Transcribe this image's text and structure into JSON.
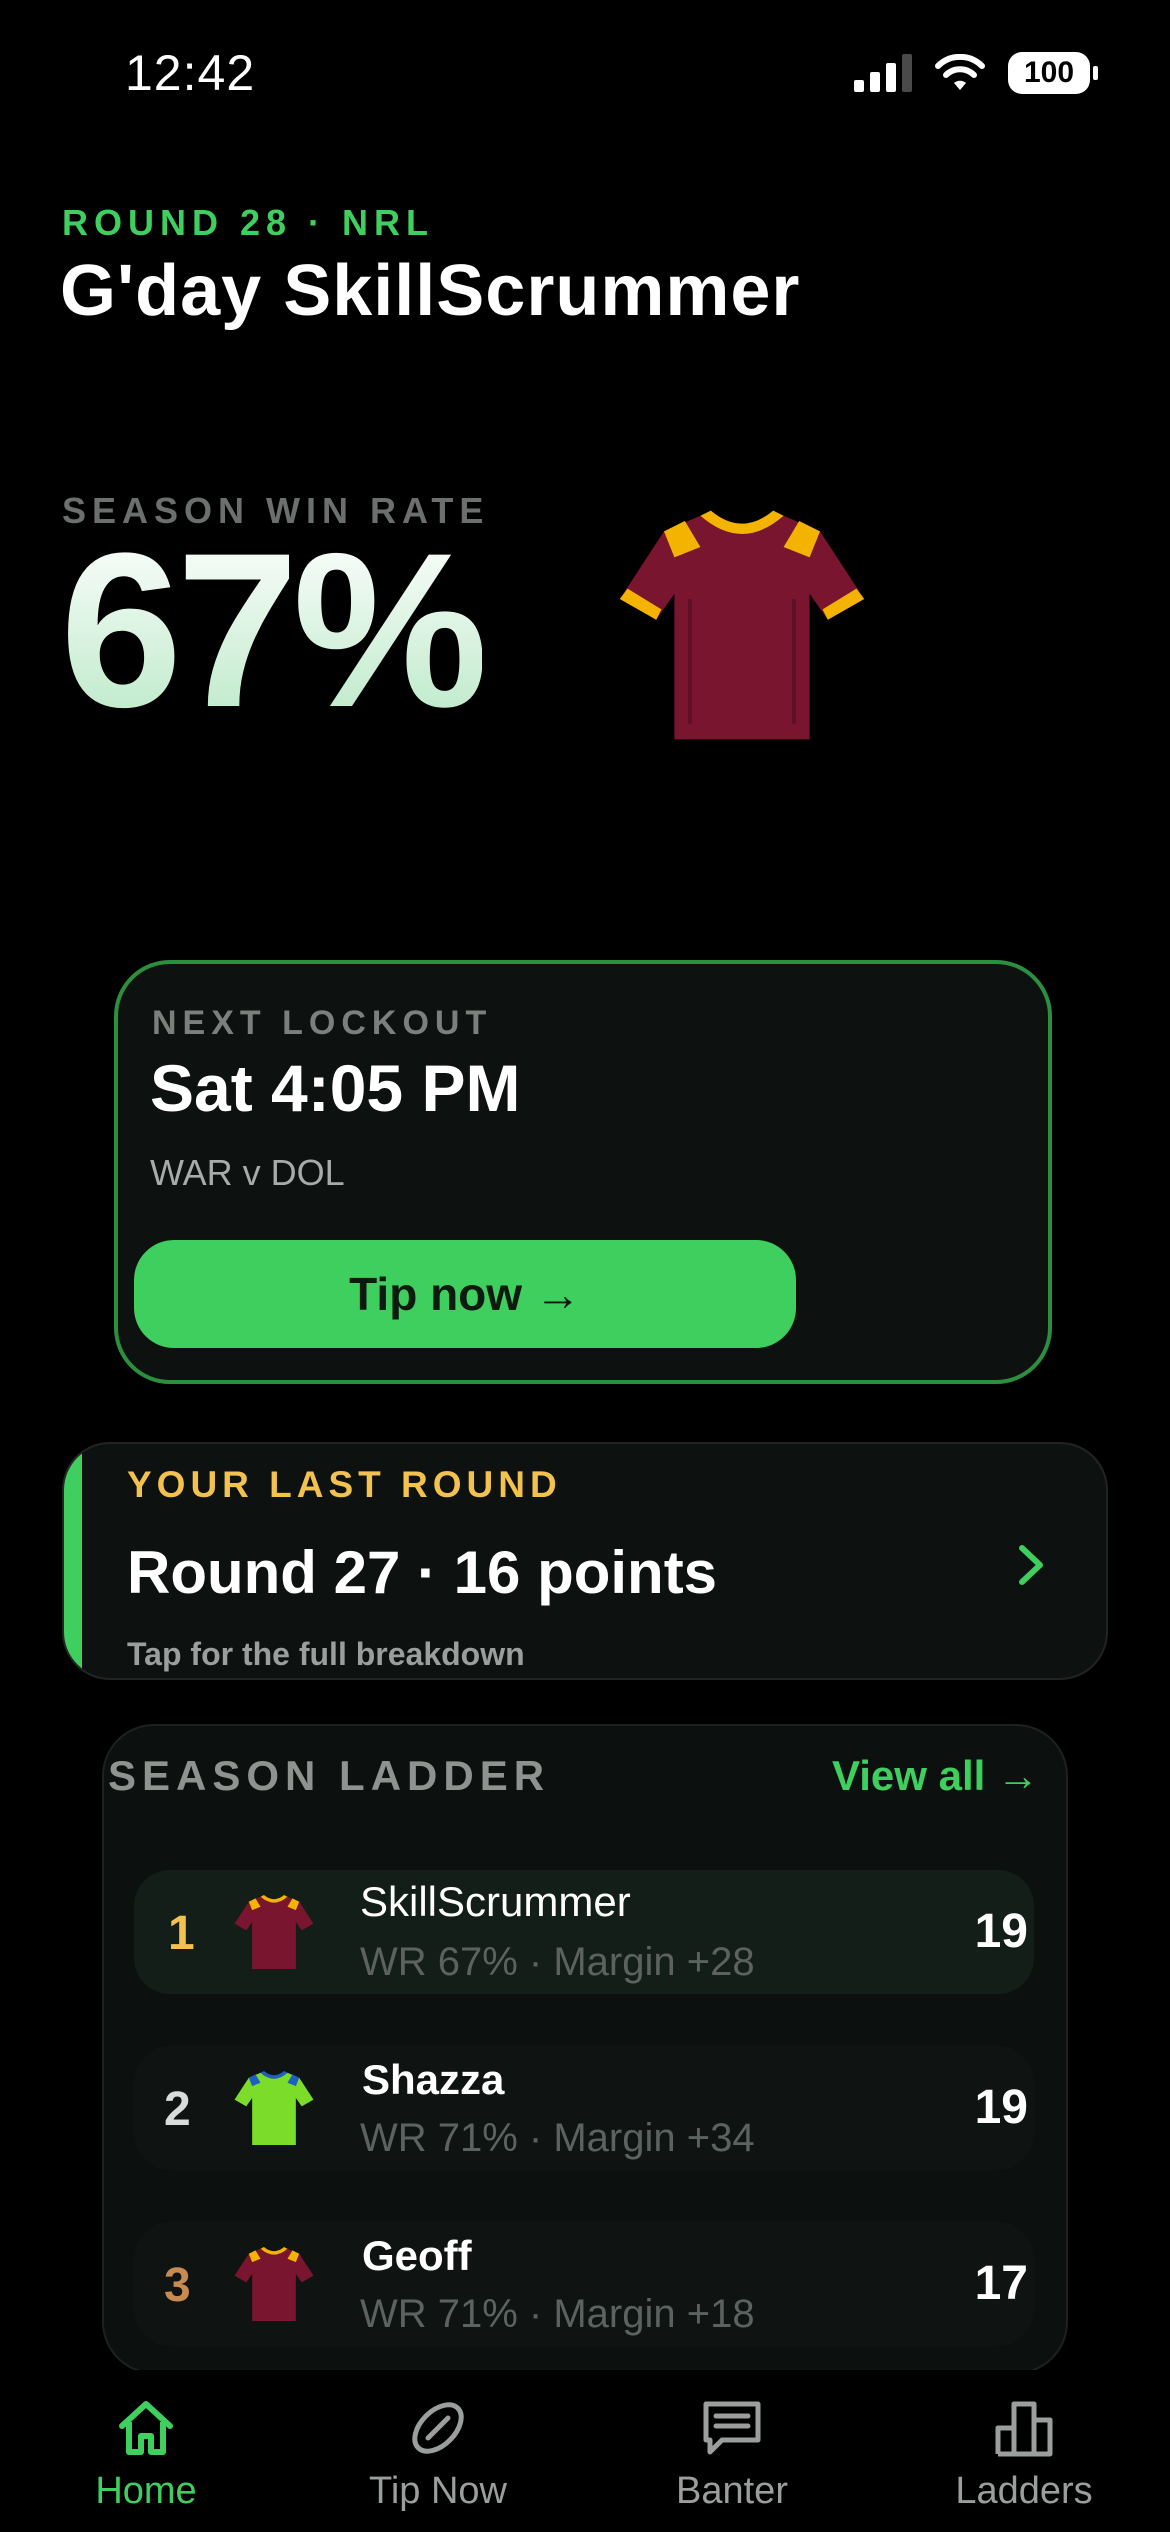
{
  "status_bar": {
    "time": "12:42",
    "battery": "100"
  },
  "header": {
    "round_label": "ROUND 28 · NRL",
    "greeting": "G'day SkillScrummer"
  },
  "stats": {
    "win_rate_label": "SEASON WIN RATE",
    "win_rate_value": "67%"
  },
  "lockout": {
    "label": "NEXT LOCKOUT",
    "time": "Sat 4:05 PM",
    "match": "WAR v DOL",
    "button_label": "Tip now →"
  },
  "last_round": {
    "label": "YOUR LAST ROUND",
    "title": "Round 27 · 16 points",
    "subtitle": "Tap for the full breakdown"
  },
  "ladder": {
    "title": "SEASON LADDER",
    "view_all": "View all →",
    "rows": [
      {
        "rank": "1",
        "name": "SkillScrummer",
        "meta": "WR 67% · Margin +28",
        "score": "19",
        "rank_color": "#f2c14e",
        "jersey": "maroon-gold"
      },
      {
        "rank": "2",
        "name": "Shazza",
        "meta": "WR 71% · Margin +34",
        "score": "19",
        "rank_color": "#d8dcda",
        "jersey": "lime-blue"
      },
      {
        "rank": "3",
        "name": "Geoff",
        "meta": "WR 71% · Margin +18",
        "score": "17",
        "rank_color": "#c98a52",
        "jersey": "maroon-gold"
      }
    ]
  },
  "tabs": [
    {
      "label": "Home",
      "icon": "home-icon",
      "active": true
    },
    {
      "label": "Tip Now",
      "icon": "football-icon",
      "active": false
    },
    {
      "label": "Banter",
      "icon": "chat-icon",
      "active": false
    },
    {
      "label": "Ladders",
      "icon": "ladder-chart-icon",
      "active": false
    }
  ],
  "colors": {
    "accent": "#3ecf5e",
    "gold": "#f2c14e",
    "bronze": "#c98a52",
    "background": "#000000"
  }
}
